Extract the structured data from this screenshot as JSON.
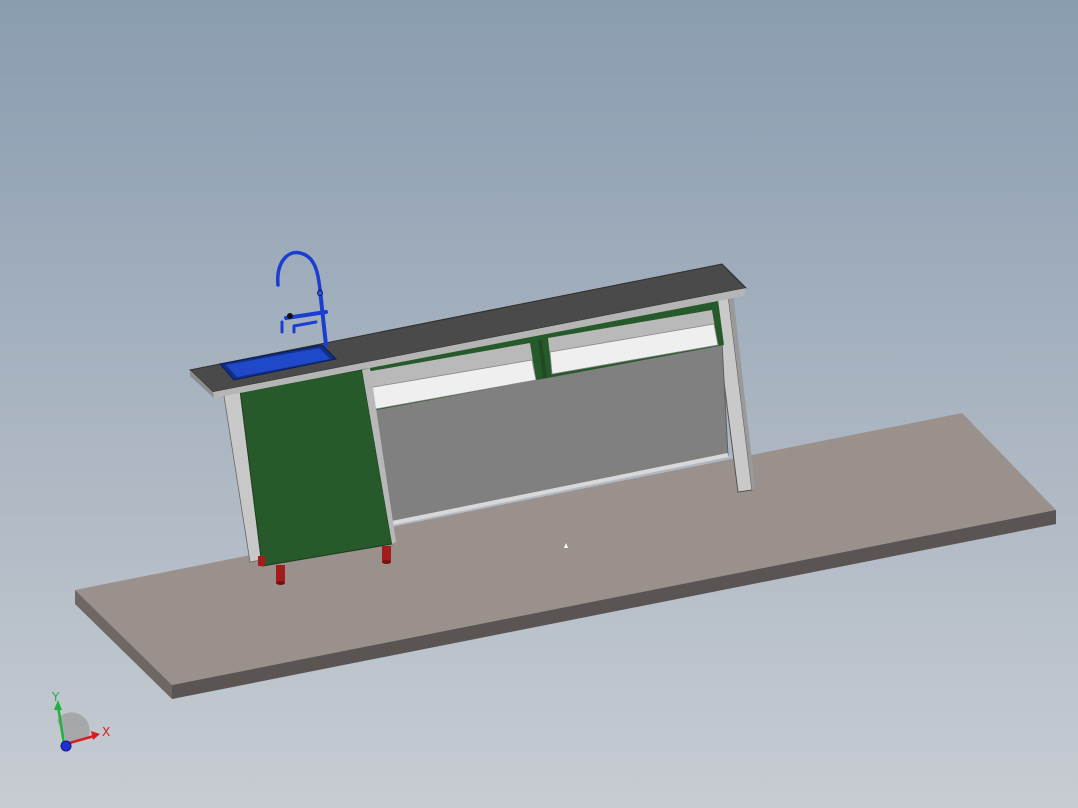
{
  "viewport": {
    "background_top": "#8a9cb0",
    "background_bottom": "#c7ccd2"
  },
  "model": {
    "floor_color": "#9a918c",
    "countertop_color": "#4a4a4a",
    "cabinet_panel_color": "#275a2b",
    "carcass_color": "#c8c8c8",
    "shelf_color": "#f0f0f0",
    "sink_color": "#1a3fb0",
    "faucet_color": "#1a3fd0",
    "leg_color": "#a31c1c"
  },
  "triad": {
    "x_label": "X",
    "y_label": "Y",
    "x_color": "#d42020",
    "y_color": "#20b040",
    "z_color": "#2030d0"
  }
}
